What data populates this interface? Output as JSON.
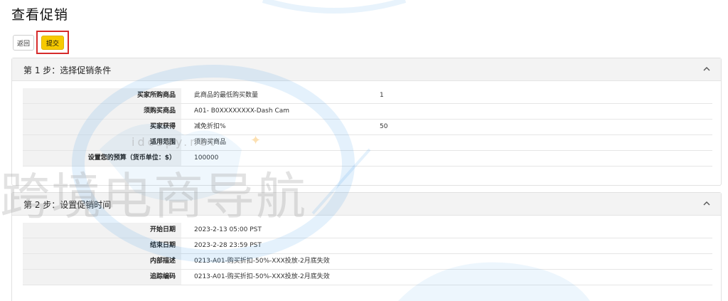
{
  "page": {
    "title": "查看促销"
  },
  "toolbar": {
    "back_label": "返回",
    "submit_label": "提交"
  },
  "step1": {
    "title": "第 1 步：选择促销条件",
    "rows": [
      {
        "label": "买家所购商品",
        "value": "此商品的最低购买数量",
        "extra": "1"
      },
      {
        "label": "须购买商品",
        "value": "A01- B0XXXXXXXX-Dash Cam",
        "extra": ""
      },
      {
        "label": "买家获得",
        "value": "减免折扣%",
        "extra": "50"
      },
      {
        "label": "适用范围",
        "value": "须购买商品",
        "extra": ""
      },
      {
        "label": "设置您的预算（货币单位：$）",
        "value": "100000",
        "extra": ""
      }
    ]
  },
  "step2": {
    "title": "第 2 步：设置促销时间",
    "rows": [
      {
        "label": "开始日期",
        "value": "2023-2-13  05:00  PST"
      },
      {
        "label": "结束日期",
        "value": "2023-2-28  23:59  PST"
      },
      {
        "label": "内部描述",
        "value": "0213-A01-购买折扣-50%-XXX投放-2月底失效"
      },
      {
        "label": "追踪编码",
        "value": "0213-A01-购买折扣-50%-XXX投放-2月底失效"
      }
    ]
  },
  "watermark": {
    "text": "跨境电商导航",
    "sub": "idcspy.net"
  }
}
